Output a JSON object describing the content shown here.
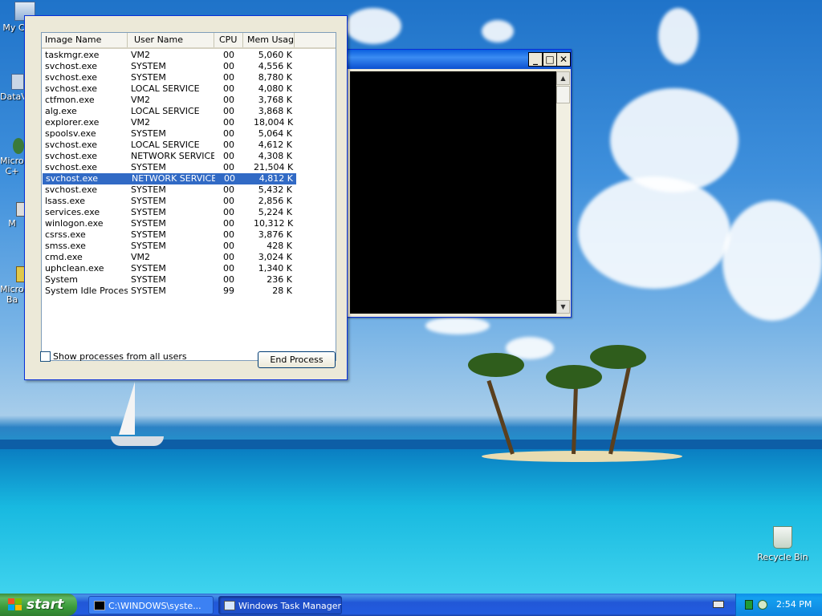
{
  "desktop": {
    "icons": [
      {
        "label": "My C"
      },
      {
        "label": "DataV"
      },
      {
        "label": "Micros C+"
      },
      {
        "label": "M"
      },
      {
        "label": "Micros Ba"
      },
      {
        "label": "Recycle Bin"
      }
    ]
  },
  "task_manager": {
    "columns": [
      "Image Name",
      "User Name",
      "CPU",
      "Mem Usage"
    ],
    "processes": [
      {
        "image": "taskmgr.exe",
        "user": "VM2",
        "cpu": "00",
        "mem": "5,060 K"
      },
      {
        "image": "svchost.exe",
        "user": "SYSTEM",
        "cpu": "00",
        "mem": "4,556 K"
      },
      {
        "image": "svchost.exe",
        "user": "SYSTEM",
        "cpu": "00",
        "mem": "8,780 K"
      },
      {
        "image": "svchost.exe",
        "user": "LOCAL SERVICE",
        "cpu": "00",
        "mem": "4,080 K"
      },
      {
        "image": "ctfmon.exe",
        "user": "VM2",
        "cpu": "00",
        "mem": "3,768 K"
      },
      {
        "image": "alg.exe",
        "user": "LOCAL SERVICE",
        "cpu": "00",
        "mem": "3,868 K"
      },
      {
        "image": "explorer.exe",
        "user": "VM2",
        "cpu": "00",
        "mem": "18,004 K"
      },
      {
        "image": "spoolsv.exe",
        "user": "SYSTEM",
        "cpu": "00",
        "mem": "5,064 K"
      },
      {
        "image": "svchost.exe",
        "user": "LOCAL SERVICE",
        "cpu": "00",
        "mem": "4,612 K"
      },
      {
        "image": "svchost.exe",
        "user": "NETWORK SERVICE",
        "cpu": "00",
        "mem": "4,308 K"
      },
      {
        "image": "svchost.exe",
        "user": "SYSTEM",
        "cpu": "00",
        "mem": "21,504 K"
      },
      {
        "image": "svchost.exe",
        "user": "NETWORK SERVICE",
        "cpu": "00",
        "mem": "4,812 K",
        "selected": true
      },
      {
        "image": "svchost.exe",
        "user": "SYSTEM",
        "cpu": "00",
        "mem": "5,432 K"
      },
      {
        "image": "lsass.exe",
        "user": "SYSTEM",
        "cpu": "00",
        "mem": "2,856 K"
      },
      {
        "image": "services.exe",
        "user": "SYSTEM",
        "cpu": "00",
        "mem": "5,224 K"
      },
      {
        "image": "winlogon.exe",
        "user": "SYSTEM",
        "cpu": "00",
        "mem": "10,312 K"
      },
      {
        "image": "csrss.exe",
        "user": "SYSTEM",
        "cpu": "00",
        "mem": "3,876 K"
      },
      {
        "image": "smss.exe",
        "user": "SYSTEM",
        "cpu": "00",
        "mem": "428 K"
      },
      {
        "image": "cmd.exe",
        "user": "VM2",
        "cpu": "00",
        "mem": "3,024 K"
      },
      {
        "image": "uphclean.exe",
        "user": "SYSTEM",
        "cpu": "00",
        "mem": "1,340 K"
      },
      {
        "image": "System",
        "user": "SYSTEM",
        "cpu": "00",
        "mem": "236 K"
      },
      {
        "image": "System Idle Process",
        "user": "SYSTEM",
        "cpu": "99",
        "mem": "28 K"
      }
    ],
    "show_all_users_label": "Show processes from all users",
    "show_all_users_checked": false,
    "end_process_label": "End Process"
  },
  "console_window": {
    "minimize_glyph": "_",
    "maximize_glyph": "□",
    "close_glyph": "✕",
    "scroll_up_glyph": "▲",
    "scroll_down_glyph": "▼"
  },
  "taskbar": {
    "start_label": "start",
    "tasks": [
      {
        "label": "C:\\WINDOWS\\syste...",
        "icon": "console-icon"
      },
      {
        "label": "Windows Task Manager",
        "icon": "task-manager-icon"
      }
    ],
    "clock": "2:54 PM"
  },
  "colors": {
    "selection": "#316ac5",
    "xp_blue": "#235ce0",
    "start_green": "#3b9b3b"
  }
}
